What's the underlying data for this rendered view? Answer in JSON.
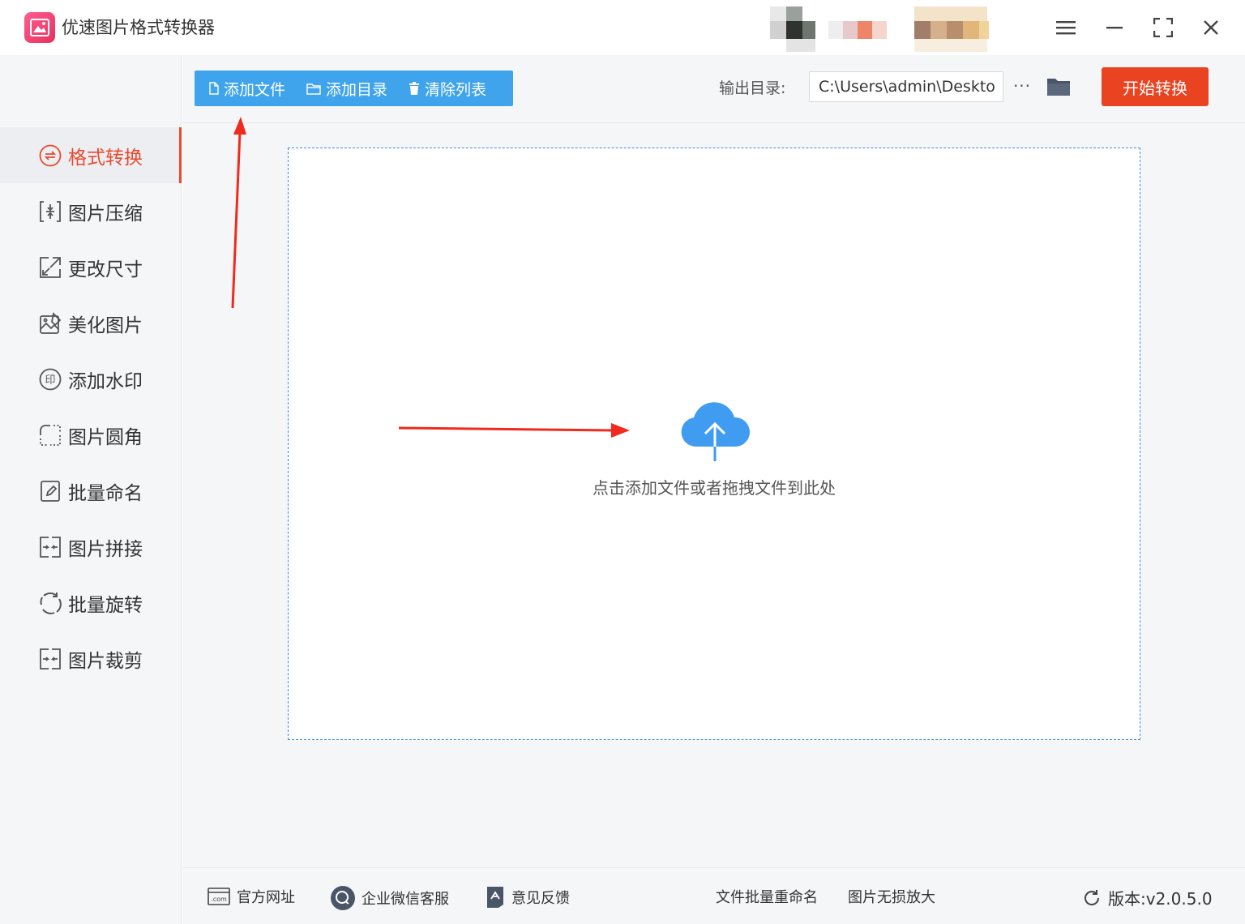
{
  "app": {
    "title": "优速图片格式转换器"
  },
  "toolbar": {
    "add_file": "添加文件",
    "add_folder": "添加目录",
    "clear_list": "清除列表",
    "output_label": "输出目录:",
    "output_path": "C:\\Users\\admin\\Deskto",
    "more": "···",
    "start": "开始转换"
  },
  "sidebar": {
    "items": [
      {
        "label": "格式转换",
        "icon": "convert-icon",
        "active": true
      },
      {
        "label": "图片压缩",
        "icon": "compress-icon"
      },
      {
        "label": "更改尺寸",
        "icon": "resize-icon"
      },
      {
        "label": "美化图片",
        "icon": "beautify-icon"
      },
      {
        "label": "添加水印",
        "icon": "watermark-icon"
      },
      {
        "label": "图片圆角",
        "icon": "rounded-corner-icon"
      },
      {
        "label": "批量命名",
        "icon": "rename-icon"
      },
      {
        "label": "图片拼接",
        "icon": "stitch-icon"
      },
      {
        "label": "批量旋转",
        "icon": "rotate-icon"
      },
      {
        "label": "图片裁剪",
        "icon": "crop-icon"
      }
    ]
  },
  "dropzone": {
    "hint": "点击添加文件或者拖拽文件到此处"
  },
  "footer": {
    "website": "官方网址",
    "wechat": "企业微信客服",
    "feedback": "意见反馈",
    "batch_rename": "文件批量重命名",
    "lossless_enlarge": "图片无损放大",
    "version": "版本:v2.0.5.0"
  },
  "colors": {
    "accent_blue": "#3fa4ec",
    "start_red": "#ea4321",
    "active_red": "#e84a2f",
    "cloud_blue": "#3f9cf0"
  }
}
